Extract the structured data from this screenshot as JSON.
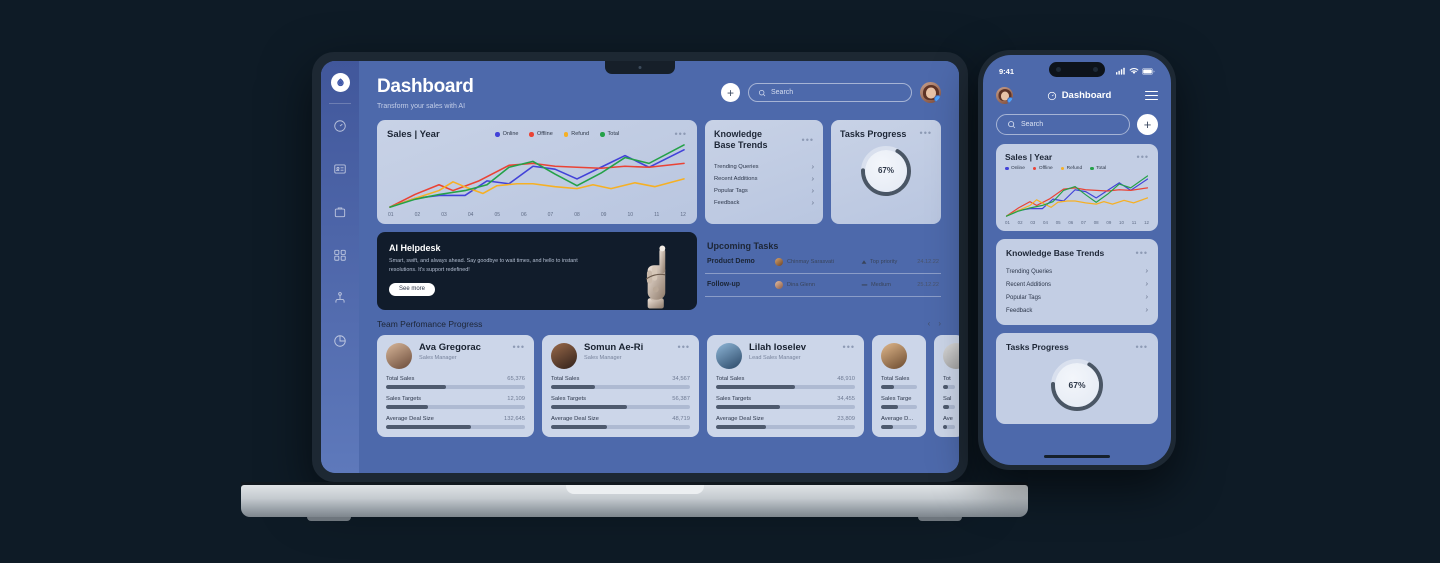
{
  "brand": {
    "accent": "#4d69ab",
    "logo_icon": "leaf-logo-icon"
  },
  "desktop": {
    "sidebar": {
      "items": [
        {
          "name": "dashboard",
          "icon": "gauge-icon"
        },
        {
          "name": "reports",
          "icon": "id-card-icon"
        },
        {
          "name": "briefcase",
          "icon": "briefcase-icon"
        },
        {
          "name": "integrations",
          "icon": "nodes-icon"
        },
        {
          "name": "team",
          "icon": "hierarchy-icon"
        },
        {
          "name": "analytics",
          "icon": "pie-chart-icon"
        }
      ]
    },
    "header": {
      "title": "Dashboard",
      "subtitle": "Transform your sales with AI",
      "add_label": "+",
      "search_placeholder": "Search",
      "search_value": "",
      "search_icon": "magnifier-icon",
      "avatar_name": "user-avatar"
    },
    "sales_card": {
      "title": "Sales | Year",
      "menu": "•••"
    },
    "knowledge_base": {
      "title": "Knowledge\nBase Trends",
      "title_line1": "Knowledge",
      "title_line2": "Base Trends",
      "menu": "•••",
      "items": [
        {
          "label": "Trending Queries"
        },
        {
          "label": "Recent Additions"
        },
        {
          "label": "Popular Tags"
        },
        {
          "label": "Feedback"
        }
      ]
    },
    "tasks_progress": {
      "title": "Tasks Progress",
      "menu": "•••",
      "percent_label": "67%",
      "percent": 67,
      "track_color": "#d9e0ee",
      "arc_color": "#4a5665"
    },
    "ai_helpdesk": {
      "title": "AI Helpdesk",
      "description": "Smart, swift, and always ahead. Say goodbye to wait times, and hello to instant resolutions. It's support redefined!",
      "button": "See more"
    },
    "upcoming_tasks": {
      "title": "Upcoming Tasks",
      "rows": [
        {
          "name": "Product Demo",
          "person": "Chinmay Sarasvati",
          "priority": "Top priority",
          "priority_icon": "triangle-up-icon",
          "date": "24.12.22"
        },
        {
          "name": "Follow-up",
          "person": "Dina Glenn",
          "priority": "Medium",
          "priority_icon": "dash-icon",
          "date": "25.12.22"
        }
      ]
    },
    "team": {
      "title": "Team Perfomance Progress",
      "prev": "‹",
      "next": "›",
      "metric_labels": [
        "Total Sales",
        "Sales Targets",
        "Average Deal Size"
      ],
      "members": [
        {
          "name": "Ava Gregorac",
          "role": "Sales Manager",
          "menu": "•••",
          "metrics": [
            {
              "label": "Total Sales",
              "value": "65,376",
              "fill": 43
            },
            {
              "label": "Sales Targets",
              "value": "12,109",
              "fill": 30
            },
            {
              "label": "Average Deal Size",
              "value": "132,645",
              "fill": 61
            }
          ]
        },
        {
          "name": "Somun Ae-Ri",
          "role": "Sales Manager",
          "menu": "•••",
          "metrics": [
            {
              "label": "Total Sales",
              "value": "34,567",
              "fill": 32
            },
            {
              "label": "Sales Targets",
              "value": "56,387",
              "fill": 55
            },
            {
              "label": "Average Deal Size",
              "value": "48,719",
              "fill": 40
            }
          ]
        },
        {
          "name": "Lilah Ioselev",
          "role": "Lead Sales Manager",
          "menu": "•••",
          "metrics": [
            {
              "label": "Total Sales",
              "value": "48,910",
              "fill": 57
            },
            {
              "label": "Sales Targets",
              "value": "34,455",
              "fill": 46
            },
            {
              "label": "Average Deal Size",
              "value": "23,809",
              "fill": 36
            }
          ]
        },
        {
          "name": "",
          "role": "",
          "menu": "•••",
          "metrics": [
            {
              "label": "Total Sales",
              "value": "",
              "fill": 36
            },
            {
              "label": "Sales Targe",
              "value": "",
              "fill": 48
            },
            {
              "label": "Average D...",
              "value": "",
              "fill": 33
            }
          ]
        },
        {
          "name": "",
          "role": "",
          "menu": "",
          "metrics": [
            {
              "label": "Tot",
              "value": "",
              "fill": 40
            },
            {
              "label": "Sal",
              "value": "",
              "fill": 50
            },
            {
              "label": "Ave",
              "value": "",
              "fill": 35
            }
          ]
        }
      ]
    }
  },
  "phone": {
    "status": {
      "time": "9:41",
      "signal_icon": "cellular-icon",
      "wifi_icon": "wifi-icon",
      "battery_icon": "battery-icon"
    },
    "header": {
      "title": "Dashboard",
      "title_icon": "gauge-icon",
      "menu_icon": "hamburger-icon",
      "avatar_name": "user-avatar"
    },
    "search": {
      "placeholder": "Search",
      "value": "",
      "icon": "magnifier-icon",
      "add_label": "+"
    },
    "sales_card": {
      "title": "Sales | Year",
      "menu": "•••"
    },
    "knowledge_base": {
      "title": "Knowledge Base Trends",
      "menu": "•••",
      "items": [
        {
          "label": "Trending Queries"
        },
        {
          "label": "Recent Additions"
        },
        {
          "label": "Popular Tags"
        },
        {
          "label": "Feedback"
        }
      ]
    },
    "tasks_progress": {
      "title": "Tasks Progress",
      "menu": "•••",
      "percent_label": "67%",
      "percent": 67
    }
  },
  "chart_data": {
    "type": "line",
    "title": "Sales | Year",
    "xlabel": "",
    "ylabel": "",
    "categories": [
      "01",
      "02",
      "03",
      "04",
      "05",
      "06",
      "07",
      "08",
      "09",
      "10",
      "11",
      "12"
    ],
    "legend_position": "top-right",
    "grid": false,
    "ylim": [
      0,
      100
    ],
    "series": [
      {
        "name": "Online",
        "color": "#4242d8",
        "values": [
          2,
          10,
          14,
          14,
          30,
          28,
          58,
          54,
          42,
          56,
          78,
          62,
          86
        ]
      },
      {
        "name": "Offline",
        "color": "#ea4335",
        "values": [
          2,
          20,
          32,
          24,
          38,
          50,
          56,
          64,
          60,
          58,
          62,
          60,
          66,
          72
        ]
      },
      {
        "name": "Refund",
        "color": "#f6b024",
        "values": [
          2,
          14,
          22,
          34,
          24,
          18,
          32,
          34,
          30,
          26,
          30,
          26,
          34,
          28,
          38
        ]
      },
      {
        "name": "Total",
        "color": "#24a148",
        "values": [
          2,
          12,
          20,
          26,
          36,
          46,
          60,
          46,
          34,
          30,
          54,
          72,
          66,
          84,
          96
        ]
      }
    ]
  }
}
